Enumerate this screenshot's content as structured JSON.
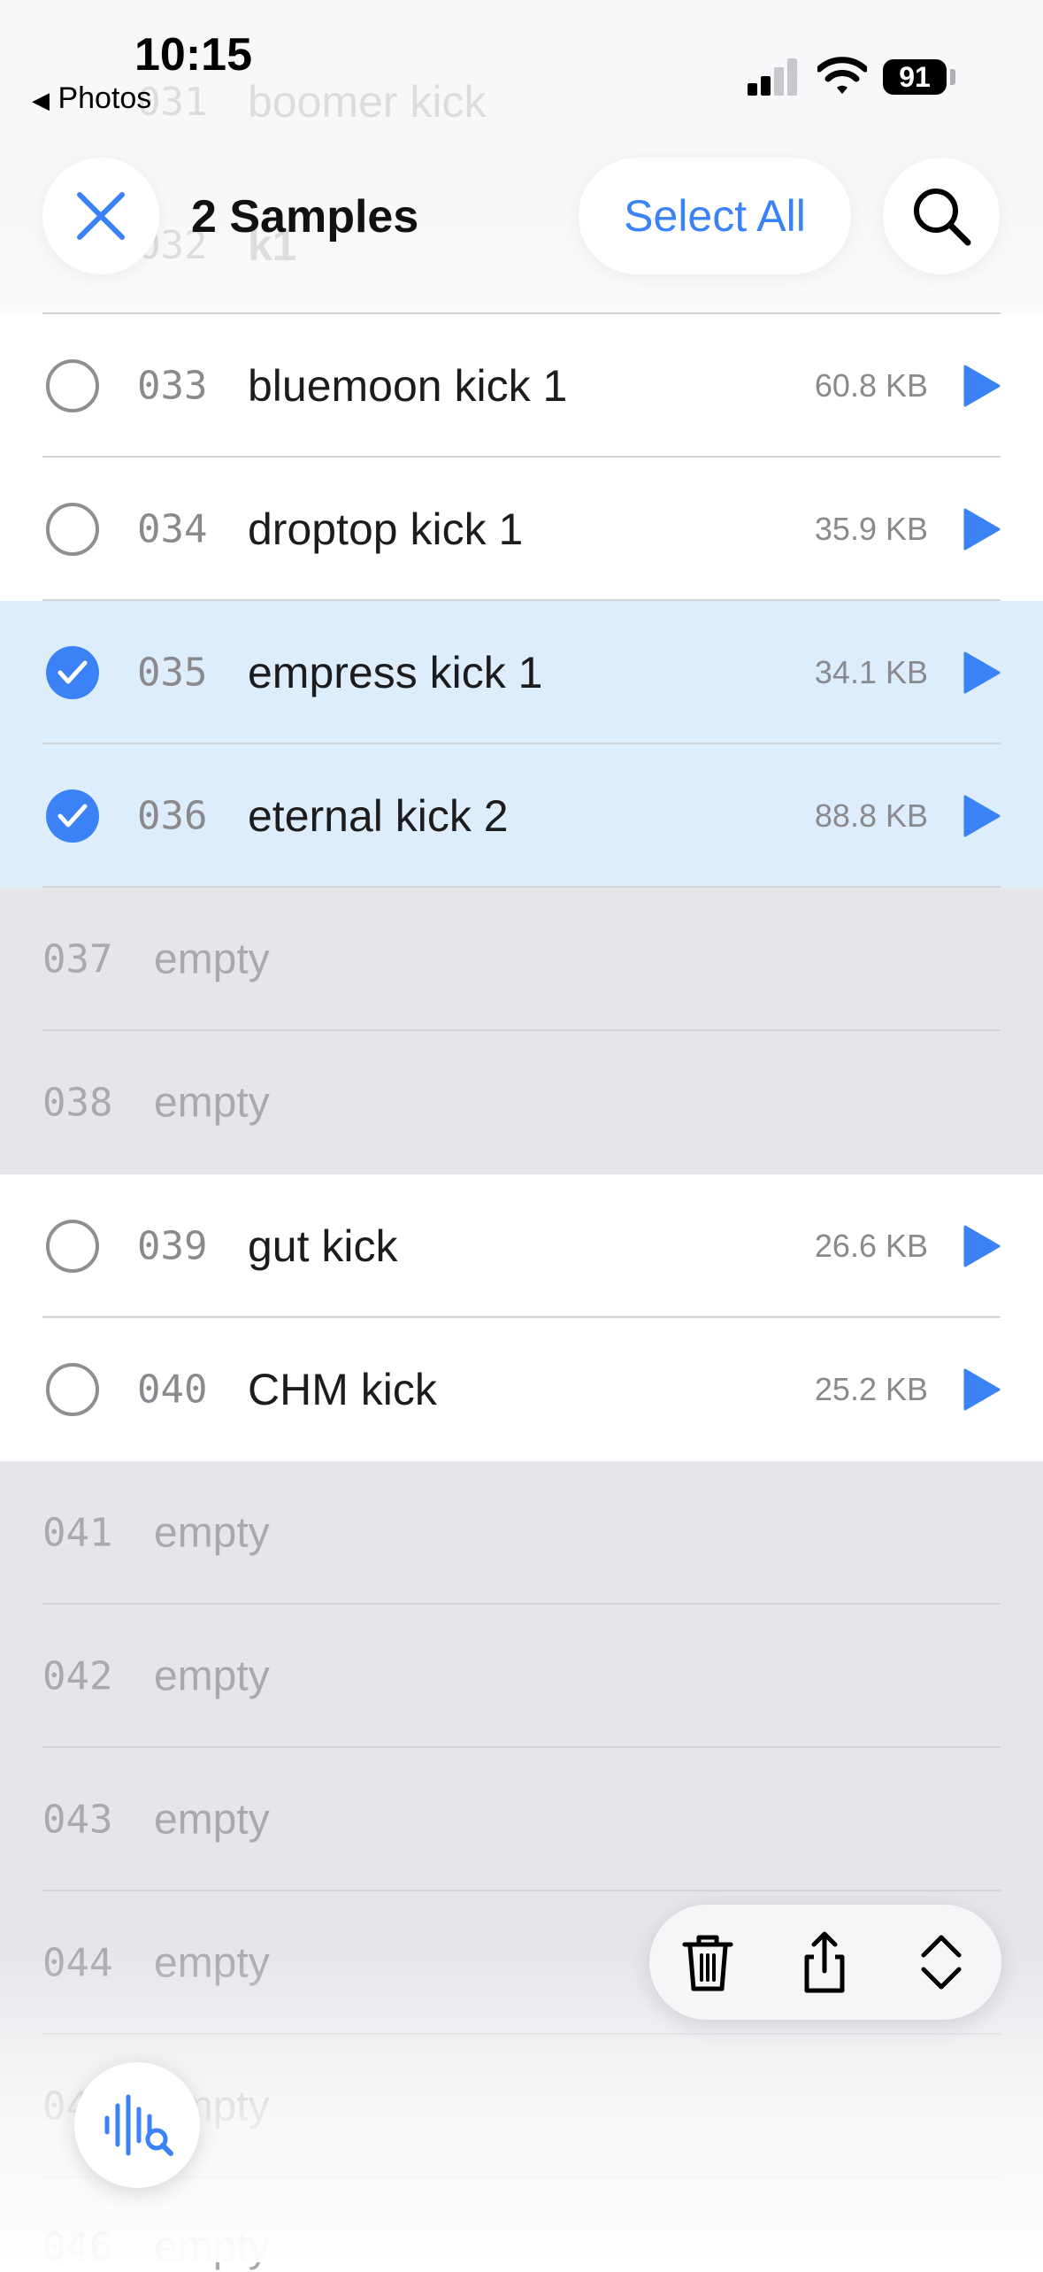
{
  "status_bar": {
    "time": "10:15",
    "back_label": "Photos",
    "battery": "91"
  },
  "header": {
    "title": "2 Samples",
    "select_all_label": "Select All"
  },
  "ghost_rows": [
    {
      "number": "031",
      "name": "boomer kick"
    },
    {
      "number": "032",
      "name": "k1"
    }
  ],
  "rows": [
    {
      "number": "033",
      "name": "bluemoon kick 1",
      "size": "60.8 KB",
      "state": "filled"
    },
    {
      "number": "034",
      "name": "droptop kick 1",
      "size": "35.9 KB",
      "state": "filled"
    },
    {
      "number": "035",
      "name": "empress kick 1",
      "size": "34.1 KB",
      "state": "selected"
    },
    {
      "number": "036",
      "name": "eternal kick 2",
      "size": "88.8 KB",
      "state": "selected"
    },
    {
      "number": "037",
      "name": "empty",
      "state": "empty"
    },
    {
      "number": "038",
      "name": "empty",
      "state": "empty"
    },
    {
      "number": "039",
      "name": "gut kick",
      "size": "26.6 KB",
      "state": "filled"
    },
    {
      "number": "040",
      "name": "CHM kick",
      "size": "25.2 KB",
      "state": "filled"
    },
    {
      "number": "041",
      "name": "empty",
      "state": "empty"
    },
    {
      "number": "042",
      "name": "empty",
      "state": "empty"
    },
    {
      "number": "043",
      "name": "empty",
      "state": "empty"
    },
    {
      "number": "044",
      "name": "empty",
      "state": "empty"
    },
    {
      "number": "045",
      "name": "empty",
      "state": "empty"
    },
    {
      "number": "046",
      "name": "empty",
      "state": "empty"
    }
  ],
  "toolbar": {
    "icons": [
      "trash-icon",
      "share-icon",
      "move-icon"
    ]
  },
  "fab": {
    "icon": "waveform-search-icon"
  },
  "colors": {
    "accent": "#3b82f6",
    "selected_bg": "#deedfc",
    "empty_bg": "#e6e5ea"
  }
}
